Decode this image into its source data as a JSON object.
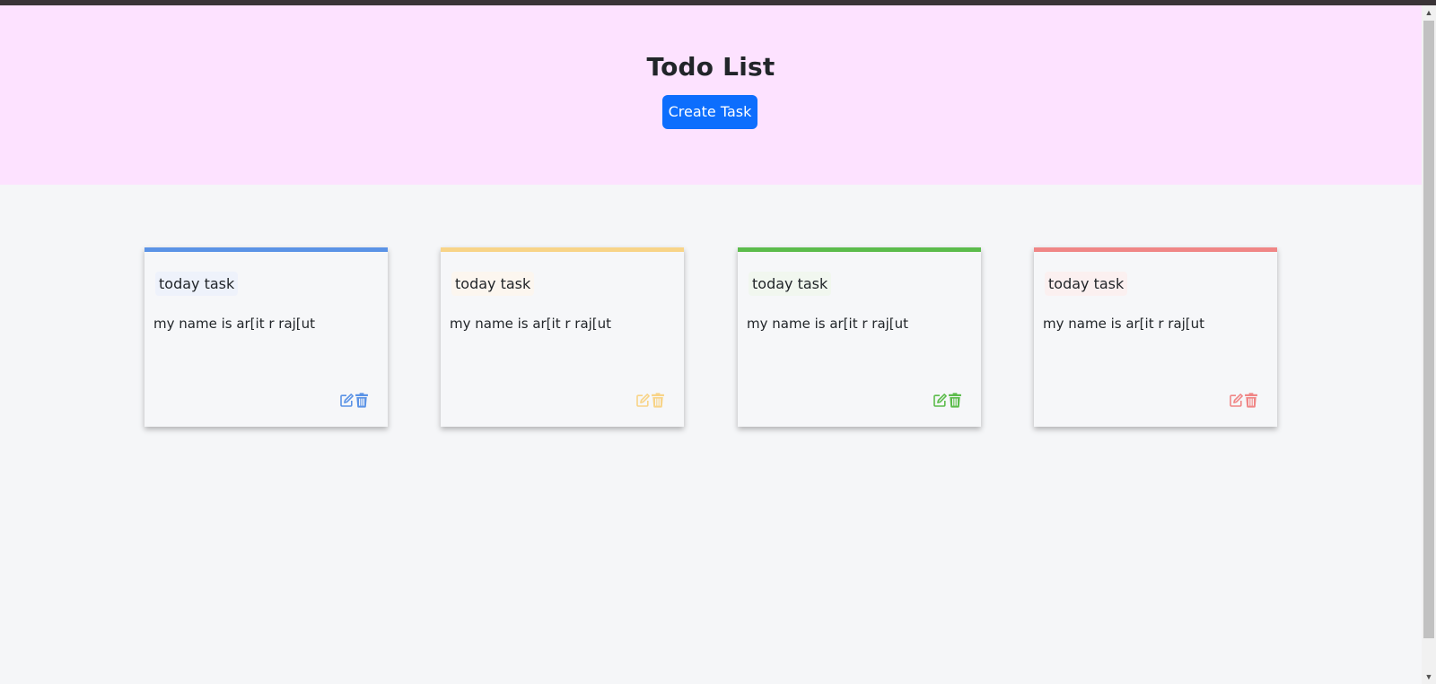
{
  "header": {
    "title": "Todo List",
    "create_label": "Create Task",
    "background": "#fde2ff",
    "button_color": "#0d6efd"
  },
  "cards": [
    {
      "title": "today task",
      "description": "my name is ar[it r raj[ut",
      "accent": "#5b93e6",
      "title_bg": "#eef2fb",
      "edit_icon": "pen-to-square-icon",
      "delete_icon": "trash-icon"
    },
    {
      "title": "today task",
      "description": "my name is ar[it r raj[ut",
      "accent": "#f8d488",
      "title_bg": "#fcf6ef",
      "edit_icon": "pen-to-square-icon",
      "delete_icon": "trash-icon"
    },
    {
      "title": "today task",
      "description": "my name is ar[it r raj[ut",
      "accent": "#5cbc4c",
      "title_bg": "#f1f7ef",
      "edit_icon": "pen-to-square-icon",
      "delete_icon": "trash-icon"
    },
    {
      "title": "today task",
      "description": "my name is ar[it r raj[ut",
      "accent": "#f08686",
      "title_bg": "#fbf0f0",
      "edit_icon": "pen-to-square-icon",
      "delete_icon": "trash-icon"
    }
  ]
}
